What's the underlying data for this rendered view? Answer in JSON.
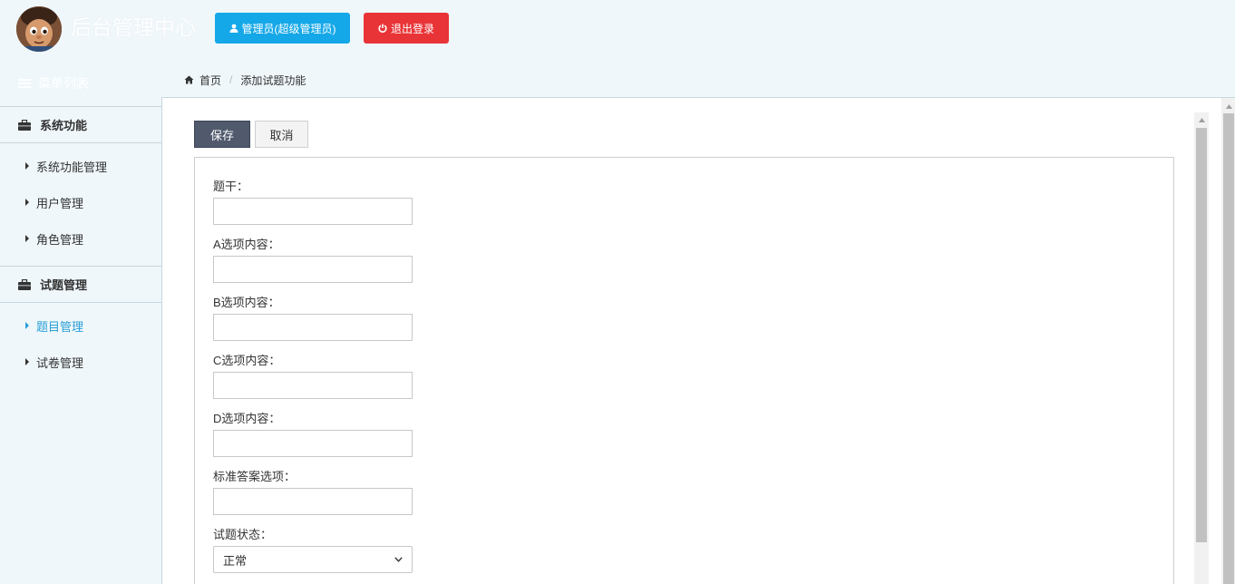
{
  "header": {
    "site_title": "后台管理中心",
    "admin_button_label": "管理员(超级管理员)",
    "logout_button_label": "退出登录"
  },
  "sidebar": {
    "menu_title": "菜单列表",
    "groups": [
      {
        "title": "系统功能",
        "items": [
          {
            "label": "系统功能管理",
            "active": false
          },
          {
            "label": "用户管理",
            "active": false
          },
          {
            "label": "角色管理",
            "active": false
          }
        ]
      },
      {
        "title": "试题管理",
        "items": [
          {
            "label": "题目管理",
            "active": true
          },
          {
            "label": "试卷管理",
            "active": false
          }
        ]
      }
    ]
  },
  "breadcrumb": {
    "home": "首页",
    "current": "添加试题功能"
  },
  "toolbar": {
    "save_label": "保存",
    "cancel_label": "取消"
  },
  "form": {
    "fields": [
      {
        "label": "题干：",
        "value": ""
      },
      {
        "label": "A选项内容：",
        "value": ""
      },
      {
        "label": "B选项内容：",
        "value": ""
      },
      {
        "label": "C选项内容：",
        "value": ""
      },
      {
        "label": "D选项内容：",
        "value": ""
      },
      {
        "label": "标准答案选项：",
        "value": ""
      }
    ],
    "status": {
      "label": "试题状态：",
      "selected": "正常"
    }
  },
  "colors": {
    "admin_button": "#15a8e8",
    "logout_button": "#e93437",
    "save_button": "#505a6c",
    "active_menu": "#2a9fd6",
    "page_background": "#eff7fb"
  }
}
